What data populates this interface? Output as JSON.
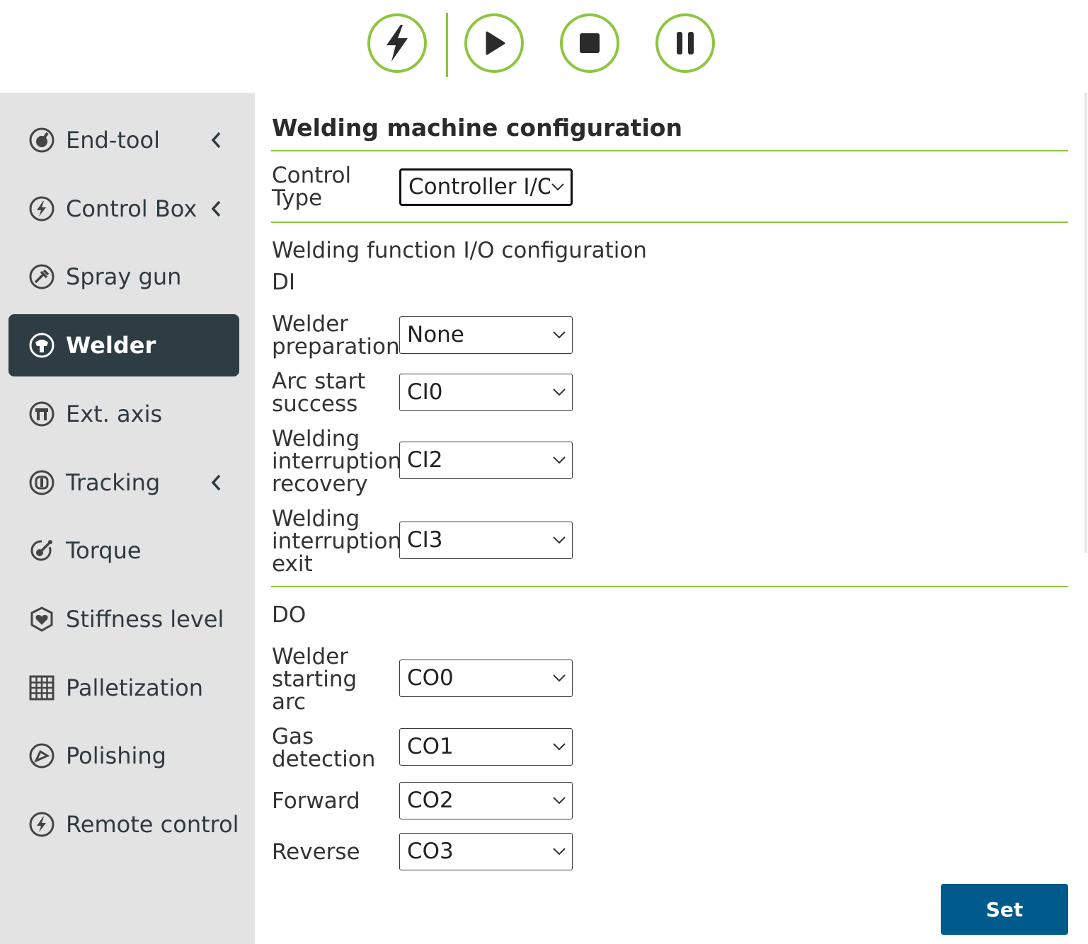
{
  "toolbar": {
    "buttons": [
      {
        "name": "enable",
        "icon": "lightning-icon"
      },
      {
        "name": "run",
        "icon": "play-icon"
      },
      {
        "name": "stop",
        "icon": "stop-icon"
      },
      {
        "name": "pause",
        "icon": "pause-icon"
      }
    ],
    "accent": "#8dc63f"
  },
  "sidebar": {
    "active_bg": "#2e3d44",
    "items": [
      {
        "label": "End-tool",
        "icon": "end-tool-icon",
        "has_submenu": true
      },
      {
        "label": "Control Box",
        "icon": "lightning-icon",
        "has_submenu": true
      },
      {
        "label": "Spray gun",
        "icon": "spray-gun-icon",
        "has_submenu": false
      },
      {
        "label": "Welder",
        "icon": "welder-icon",
        "has_submenu": false,
        "active": true
      },
      {
        "label": "Ext. axis",
        "icon": "ext-axis-icon",
        "has_submenu": false
      },
      {
        "label": "Tracking",
        "icon": "tracking-icon",
        "has_submenu": true
      },
      {
        "label": "Torque",
        "icon": "torque-icon",
        "has_submenu": false
      },
      {
        "label": "Stiffness level",
        "icon": "stiffness-icon",
        "has_submenu": false
      },
      {
        "label": "Palletization",
        "icon": "palletization-icon",
        "has_submenu": false
      },
      {
        "label": "Polishing",
        "icon": "polishing-icon",
        "has_submenu": false
      },
      {
        "label": "Remote control",
        "icon": "lightning-icon",
        "has_submenu": false
      }
    ]
  },
  "main": {
    "title": "Welding machine configuration",
    "control_type": {
      "label_line1": "Control",
      "label_line2": "Type",
      "value": "Controller I/O"
    },
    "io_section_title": "Welding function I/O configuration",
    "di": {
      "title": "DI",
      "fields": [
        {
          "lines": [
            "Welder",
            "preparation"
          ],
          "value": "None"
        },
        {
          "lines": [
            "Arc start",
            "success"
          ],
          "value": "CI0"
        },
        {
          "lines": [
            "Welding",
            "interruption",
            "recovery"
          ],
          "value": "CI2"
        },
        {
          "lines": [
            "Welding",
            "interruption",
            "exit"
          ],
          "value": "CI3"
        }
      ]
    },
    "do": {
      "title": "DO",
      "fields": [
        {
          "lines": [
            "Welder",
            "starting",
            "arc"
          ],
          "value": "CO0"
        },
        {
          "lines": [
            "Gas",
            "detection"
          ],
          "value": "CO1"
        },
        {
          "lines": [
            "Forward"
          ],
          "value": "CO2"
        },
        {
          "lines": [
            "Reverse"
          ],
          "value": "CO3"
        }
      ]
    },
    "set_label": "Set",
    "set_color": "#005b8c"
  }
}
